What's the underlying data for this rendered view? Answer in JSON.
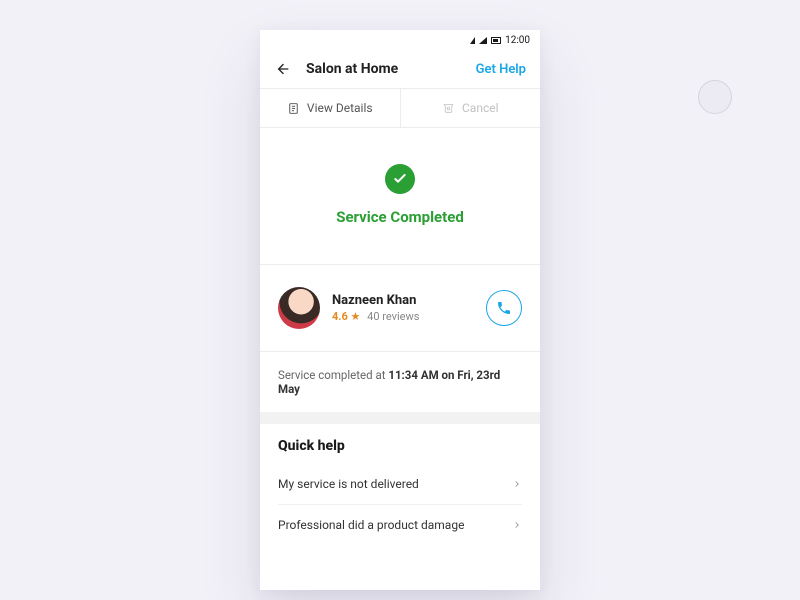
{
  "statusbar": {
    "time": "12:00"
  },
  "header": {
    "title": "Salon at Home",
    "help_label": "Get Help",
    "actions": {
      "view_details": "View Details",
      "cancel": "Cancel"
    }
  },
  "status": {
    "label": "Service Completed"
  },
  "professional": {
    "name": "Nazneen Khan",
    "rating": "4.6",
    "reviews": "40 reviews"
  },
  "completion": {
    "prefix": "Service completed at ",
    "time": "11:34 AM on Fri, 23rd May"
  },
  "quick_help": {
    "title": "Quick help",
    "items": [
      {
        "label": "My service is not delivered"
      },
      {
        "label": "Professional did a product damage"
      }
    ]
  }
}
